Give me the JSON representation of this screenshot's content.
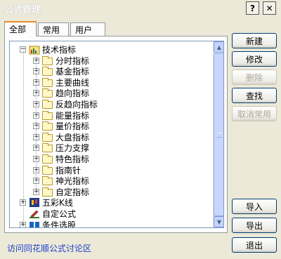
{
  "window": {
    "title": "公式管理",
    "help_glyph": "?",
    "close_glyph": "✕"
  },
  "tabs": [
    {
      "label": "全部",
      "active": true
    },
    {
      "label": "常用",
      "active": false
    },
    {
      "label": "用户",
      "active": false
    }
  ],
  "tree": {
    "root": {
      "label": "技术指标",
      "icon": "chart-folder-icon",
      "expander": "−"
    },
    "children": [
      {
        "label": "分时指标",
        "expander": "+",
        "icon": "folder-icon"
      },
      {
        "label": "基金指标",
        "expander": "+",
        "icon": "folder-icon"
      },
      {
        "label": "主要曲线",
        "expander": "+",
        "icon": "folder-icon"
      },
      {
        "label": "趋向指标",
        "expander": "+",
        "icon": "folder-icon"
      },
      {
        "label": "反趋向指标",
        "expander": "+",
        "icon": "folder-icon"
      },
      {
        "label": "能量指标",
        "expander": "+",
        "icon": "folder-icon"
      },
      {
        "label": "量价指标",
        "expander": "+",
        "icon": "folder-icon"
      },
      {
        "label": "大盘指标",
        "expander": "+",
        "icon": "folder-icon"
      },
      {
        "label": "压力支撑",
        "expander": "+",
        "icon": "folder-icon"
      },
      {
        "label": "特色指标",
        "expander": "+",
        "icon": "folder-icon"
      },
      {
        "label": "指南针",
        "expander": "+",
        "icon": "folder-icon"
      },
      {
        "label": "神光指标",
        "expander": "+",
        "icon": "folder-icon"
      },
      {
        "label": "自定指标",
        "expander": "+",
        "icon": "folder-icon"
      }
    ],
    "others": [
      {
        "label": "五彩K线",
        "expander": "+",
        "icon": "candle-icon"
      },
      {
        "label": "自定公式",
        "expander": "",
        "icon": "pencil-icon"
      },
      {
        "label": "条件选股",
        "expander": "+",
        "icon": "stock-pick-icon"
      }
    ]
  },
  "buttons": {
    "new": "新建",
    "edit": "修改",
    "delete": "删除",
    "find": "查找",
    "uncommon": "取消常用",
    "import": "导入",
    "export": "导出",
    "exit": "退出"
  },
  "footer": {
    "link": "访问同花顺公式讨论区"
  },
  "colors": {
    "dialog_bg": "#ece9d8",
    "tab_accent": "#e68b2c",
    "link": "#1a3fcc",
    "folder": "#fff8c8"
  }
}
